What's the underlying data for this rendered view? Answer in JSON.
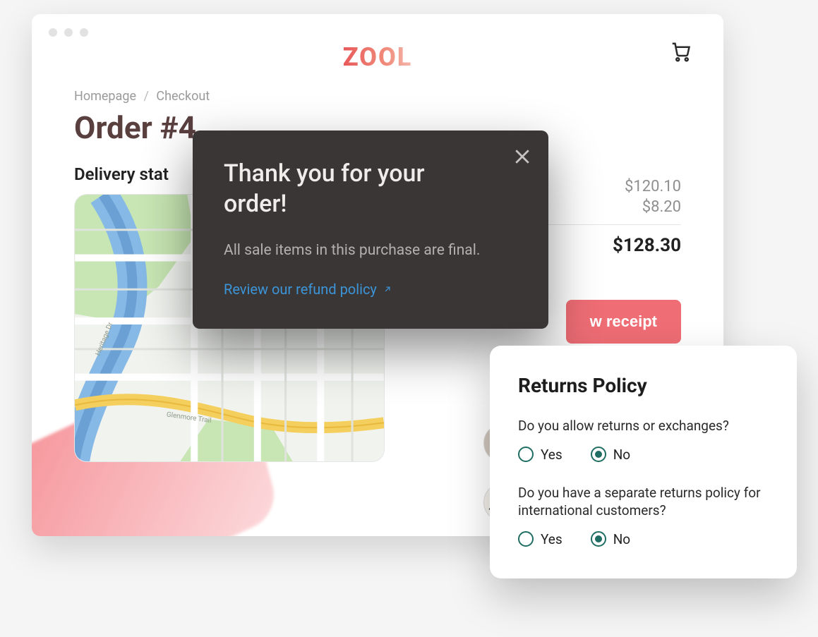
{
  "header": {
    "logo": "ZOOL"
  },
  "breadcrumb": {
    "home": "Homepage",
    "current": "Checkout"
  },
  "page": {
    "title_prefix": "Order #4",
    "delivery_label": "Delivery stat"
  },
  "totals": {
    "subtotal": "$120.10",
    "shipping": "$8.20",
    "grand": "$128.30"
  },
  "receipt_button_fragment": "w receipt",
  "map": {
    "street1": "Heritage Dr",
    "street2": "Glenmore Trail"
  },
  "modal": {
    "title": "Thank you for your order!",
    "body": "All sale items in this purchase are final.",
    "link": "Review our refund policy"
  },
  "returns_card": {
    "title": "Returns Policy",
    "q1": "Do you allow returns or exchanges?",
    "q2": "Do you have a separate returns policy for international customers?",
    "yes": "Yes",
    "no": "No",
    "q1_selected": "No",
    "q2_selected": "No"
  }
}
